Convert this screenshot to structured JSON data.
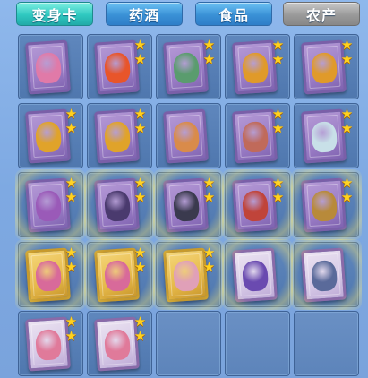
{
  "tabs": [
    {
      "label": "变身卡",
      "state": "active"
    },
    {
      "label": "药酒",
      "state": "normal"
    },
    {
      "label": "食品",
      "state": "normal"
    },
    {
      "label": "农产",
      "state": "gray"
    }
  ],
  "colors": {
    "tab_active": "#2fc8c0",
    "tab_normal": "#3a91d6",
    "tab_gray": "#9a9a9a",
    "slot_bg": "#5f87bd",
    "star": "#ffd21e"
  },
  "slots": [
    {
      "card": "purple",
      "figure": "pink-pig-doll",
      "stars": 0,
      "glow": false,
      "color": "#e07aa8"
    },
    {
      "card": "purple",
      "figure": "fire-dragon",
      "stars": 2,
      "glow": false,
      "color": "#e8552a"
    },
    {
      "card": "purple",
      "figure": "green-warrior",
      "stars": 2,
      "glow": false,
      "color": "#5a9c6e"
    },
    {
      "card": "purple",
      "figure": "golden-lion",
      "stars": 2,
      "glow": false,
      "color": "#e09a2a"
    },
    {
      "card": "purple",
      "figure": "golden-lion",
      "stars": 2,
      "glow": false,
      "color": "#e09a2a"
    },
    {
      "card": "purple",
      "figure": "golden-lion",
      "stars": 2,
      "glow": false,
      "color": "#e0a32a"
    },
    {
      "card": "purple",
      "figure": "golden-lion",
      "stars": 2,
      "glow": false,
      "color": "#e0a32a"
    },
    {
      "card": "purple",
      "figure": "fox-spirit",
      "stars": 0,
      "glow": false,
      "color": "#d98b4a"
    },
    {
      "card": "purple",
      "figure": "red-boar",
      "stars": 2,
      "glow": false,
      "color": "#c06a5a"
    },
    {
      "card": "purple",
      "figure": "white-qilin",
      "stars": 2,
      "glow": false,
      "color": "#c8e0e8"
    },
    {
      "card": "purple",
      "figure": "purple-phoenix",
      "stars": 2,
      "glow": true,
      "color": "#9a5ab8"
    },
    {
      "card": "purple",
      "figure": "dark-maiden",
      "stars": 2,
      "glow": true,
      "color": "#4a3a6e"
    },
    {
      "card": "purple",
      "figure": "dark-swordsman",
      "stars": 2,
      "glow": true,
      "color": "#3a3a4e"
    },
    {
      "card": "purple",
      "figure": "red-green-dragon",
      "stars": 2,
      "glow": true,
      "color": "#c0443a"
    },
    {
      "card": "purple",
      "figure": "golden-general",
      "stars": 2,
      "glow": true,
      "color": "#b88a3a"
    },
    {
      "card": "gold",
      "figure": "pink-fairy",
      "stars": 2,
      "glow": true,
      "color": "#d86a9a"
    },
    {
      "card": "gold",
      "figure": "pink-fairy",
      "stars": 2,
      "glow": true,
      "color": "#d86a9a"
    },
    {
      "card": "gold",
      "figure": "flower-dancer",
      "stars": 2,
      "glow": true,
      "color": "#e0a0b8"
    },
    {
      "card": "white",
      "figure": "purple-knight",
      "stars": 0,
      "glow": true,
      "color": "#6a4ab0"
    },
    {
      "card": "white",
      "figure": "armored-sage",
      "stars": 0,
      "glow": true,
      "color": "#5a6a9a"
    },
    {
      "card": "white",
      "figure": "pink-girl",
      "stars": 2,
      "glow": false,
      "color": "#e07a9a"
    },
    {
      "card": "white",
      "figure": "pink-girl",
      "stars": 2,
      "glow": false,
      "color": "#e07a9a"
    },
    {
      "card": null,
      "figure": null,
      "stars": 0,
      "glow": false,
      "color": null
    },
    {
      "card": null,
      "figure": null,
      "stars": 0,
      "glow": false,
      "color": null
    },
    {
      "card": null,
      "figure": null,
      "stars": 0,
      "glow": false,
      "color": null
    }
  ]
}
